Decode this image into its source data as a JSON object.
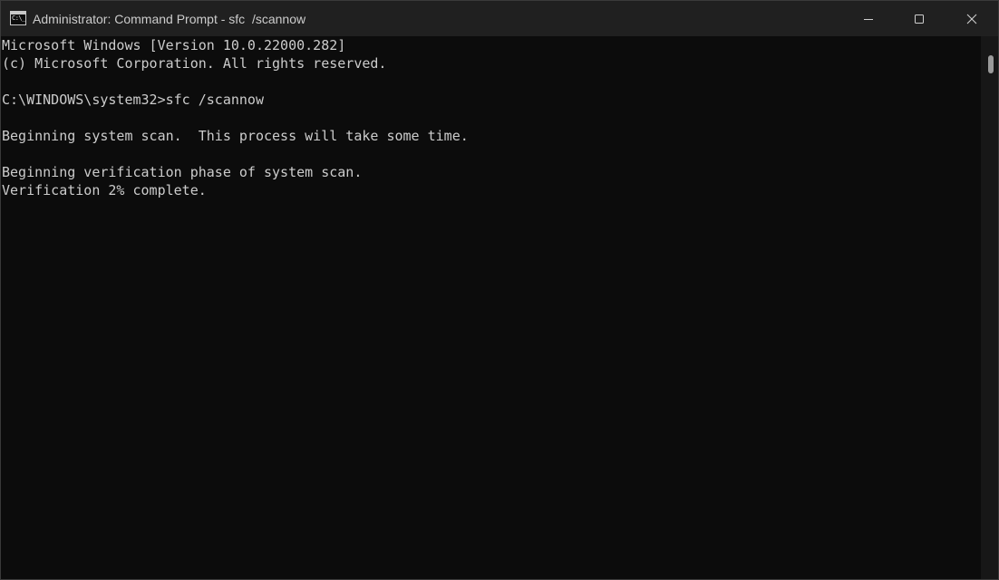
{
  "window": {
    "title": "Administrator: Command Prompt - sfc  /scannow",
    "icon": "cmd-icon",
    "icon_glyph": "C:\\_",
    "controls": {
      "minimize": "minimize-icon",
      "maximize": "maximize-icon",
      "close": "close-icon"
    }
  },
  "console": {
    "lines": [
      "Microsoft Windows [Version 10.0.22000.282]",
      "(c) Microsoft Corporation. All rights reserved.",
      "",
      "C:\\WINDOWS\\system32>sfc /scannow",
      "",
      "Beginning system scan.  This process will take some time.",
      "",
      "Beginning verification phase of system scan.",
      "Verification 2% complete."
    ]
  },
  "colors": {
    "titlebar": "#202020",
    "console_bg": "#0c0c0c",
    "console_text": "#cccccc"
  }
}
